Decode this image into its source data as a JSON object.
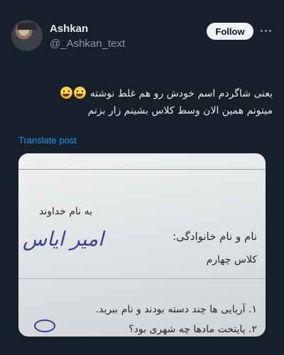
{
  "author": {
    "display_name": "Ashkan",
    "handle": "@_Ashkan_text"
  },
  "actions": {
    "follow_label": "Follow",
    "more_icon": "more-horizontal-icon"
  },
  "tweet": {
    "line1": "یعنی شاگردم اسم خودش رو هم غلط نوشته",
    "line2": "میتونم همین الان وسط کلاس بشینم زار بزنم",
    "emoji": "smiling-face-with-hand-over-mouth-emoji"
  },
  "translate_label": "Translate post",
  "media": {
    "header": "به نام خداوند",
    "name_label": "نام و نام خانوادگی:",
    "handwritten_name": "امیر ایاس",
    "class_label": "کلاس چهارم",
    "question1": "۱. آریایی ها چند دسته بودند و نام ببرید.",
    "question2": "۲. پایتخت مادها چه شهری بود؟"
  },
  "colors": {
    "background": "#15202b",
    "accent": "#1d9bf0",
    "text": "#e7e9ea",
    "muted": "#8b98a5"
  }
}
